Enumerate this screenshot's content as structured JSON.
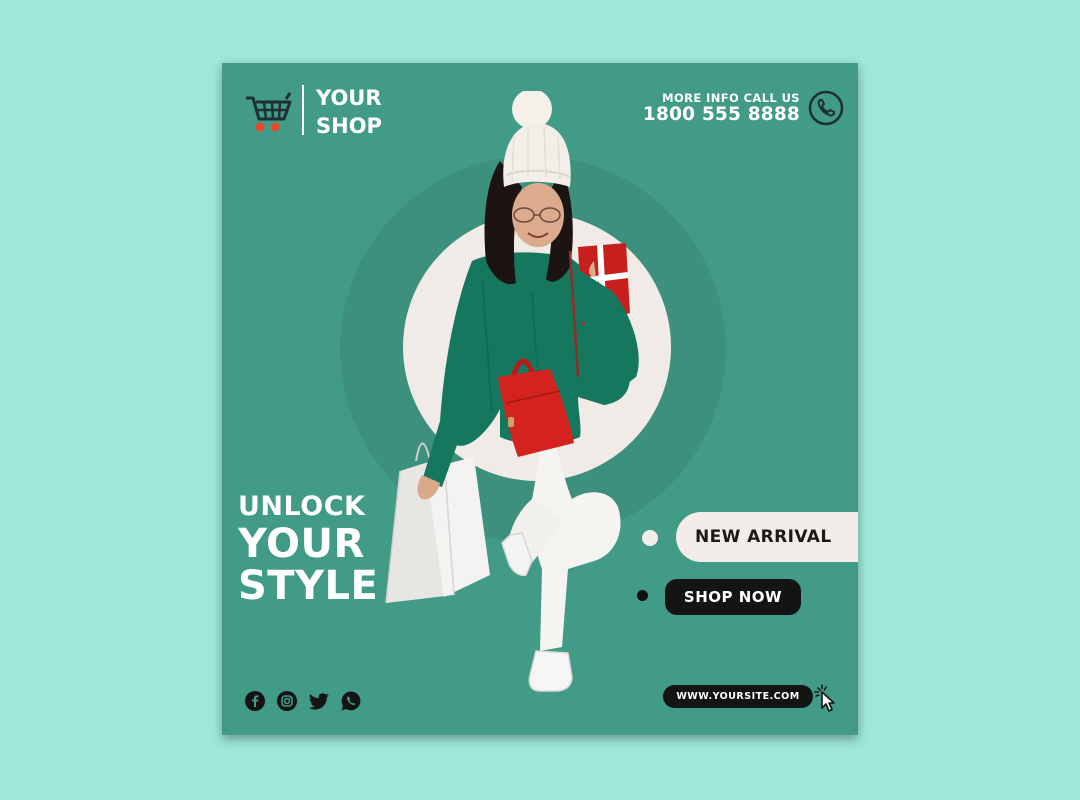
{
  "brand": {
    "line1": "YOUR",
    "line2": "SHOP"
  },
  "contact": {
    "label": "MORE INFO CALL US",
    "phone": "1800 555 8888"
  },
  "headline": {
    "line1": "UNLOCK",
    "line2": "YOUR",
    "line3": "STYLE"
  },
  "buttons": {
    "new_arrival": "NEW ARRIVAL",
    "shop_now": "SHOP NOW"
  },
  "website": "WWW.YOURSITE.COM",
  "social_icons": [
    "facebook-icon",
    "instagram-icon",
    "twitter-icon",
    "whatsapp-icon"
  ],
  "colors": {
    "background": "#9fe8d9",
    "card": "#419b87",
    "accent": "#e8492a",
    "sweater": "#16775f",
    "bag": "#d4221e",
    "cream": "#f2ede9",
    "dark": "#141414"
  }
}
